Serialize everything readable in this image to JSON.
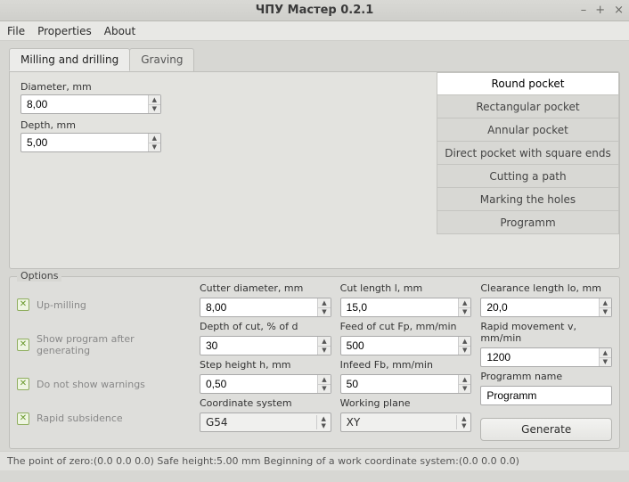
{
  "window": {
    "title": "ЧПУ Мастер 0.2.1"
  },
  "menu": {
    "file": "File",
    "properties": "Properties",
    "about": "About"
  },
  "tabs": {
    "milling": "Milling and drilling",
    "graving": "Graving"
  },
  "params": {
    "diameter_label": "Diameter, mm",
    "diameter_value": "8,00",
    "depth_label": "Depth, mm",
    "depth_value": "5,00"
  },
  "operations": [
    "Round pocket",
    "Rectangular pocket",
    "Annular pocket",
    "Direct pocket with square ends",
    "Cutting a path",
    "Marking the holes",
    "Programm"
  ],
  "options_label": "Options",
  "checks": {
    "up_milling": "Up-milling",
    "show_program": "Show program after generating",
    "no_warnings": "Do not show warnings",
    "rapid_subsidence": "Rapid subsidence"
  },
  "fields": {
    "cutter_d_label": "Cutter diameter, mm",
    "cutter_d_value": "8,00",
    "doc_label": "Depth of cut, % of d",
    "doc_value": "30",
    "step_h_label": "Step height h, mm",
    "step_h_value": "0,50",
    "coord_label": "Coordinate system",
    "coord_value": "G54",
    "cut_len_label": "Cut length l, mm",
    "cut_len_value": "15,0",
    "feed_fp_label": "Feed of cut Fp, mm/min",
    "feed_fp_value": "500",
    "infeed_fb_label": "Infeed Fb, mm/min",
    "infeed_fb_value": "50",
    "plane_label": "Working plane",
    "plane_value": "XY",
    "clearance_label": "Clearance length lo, mm",
    "clearance_value": "20,0",
    "rapid_label": "Rapid movement v, mm/min",
    "rapid_value": "1200",
    "prog_name_label": "Programm name",
    "prog_name_value": "Programm",
    "generate": "Generate"
  },
  "status": "The point of zero:(0.0  0.0  0.0)    Safe height:5.00 mm   Beginning of a work coordinate system:(0.0  0.0  0.0)"
}
